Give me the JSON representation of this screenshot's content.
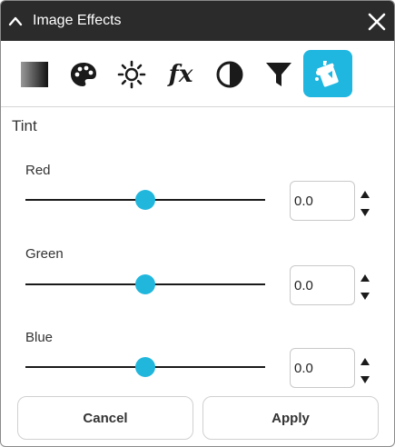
{
  "window": {
    "title": "Image Effects",
    "icons": {
      "collapse": "chevron-up-icon",
      "close": "close-icon"
    }
  },
  "toolbar": {
    "tools": [
      {
        "name": "gradient",
        "icon": "gradient-icon",
        "active": false
      },
      {
        "name": "color",
        "icon": "palette-icon",
        "active": false
      },
      {
        "name": "brightness",
        "icon": "brightness-icon",
        "active": false
      },
      {
        "name": "effects",
        "icon": "fx-icon",
        "label": "fx",
        "active": false
      },
      {
        "name": "contrast",
        "icon": "contrast-icon",
        "active": false
      },
      {
        "name": "filter",
        "icon": "filter-icon",
        "active": false
      },
      {
        "name": "tint",
        "icon": "tint-bucket-icon",
        "active": true
      }
    ]
  },
  "section": {
    "title": "Tint"
  },
  "sliders": [
    {
      "label": "Red",
      "value": "0.0",
      "slider_fraction": 0.5
    },
    {
      "label": "Green",
      "value": "0.0",
      "slider_fraction": 0.5
    },
    {
      "label": "Blue",
      "value": "0.0",
      "slider_fraction": 0.5
    }
  ],
  "buttons": {
    "cancel": "Cancel",
    "apply": "Apply"
  },
  "colors": {
    "titlebar": "#2b2b2b",
    "accent": "#1fb6e0",
    "track": "#1a1a1a"
  }
}
